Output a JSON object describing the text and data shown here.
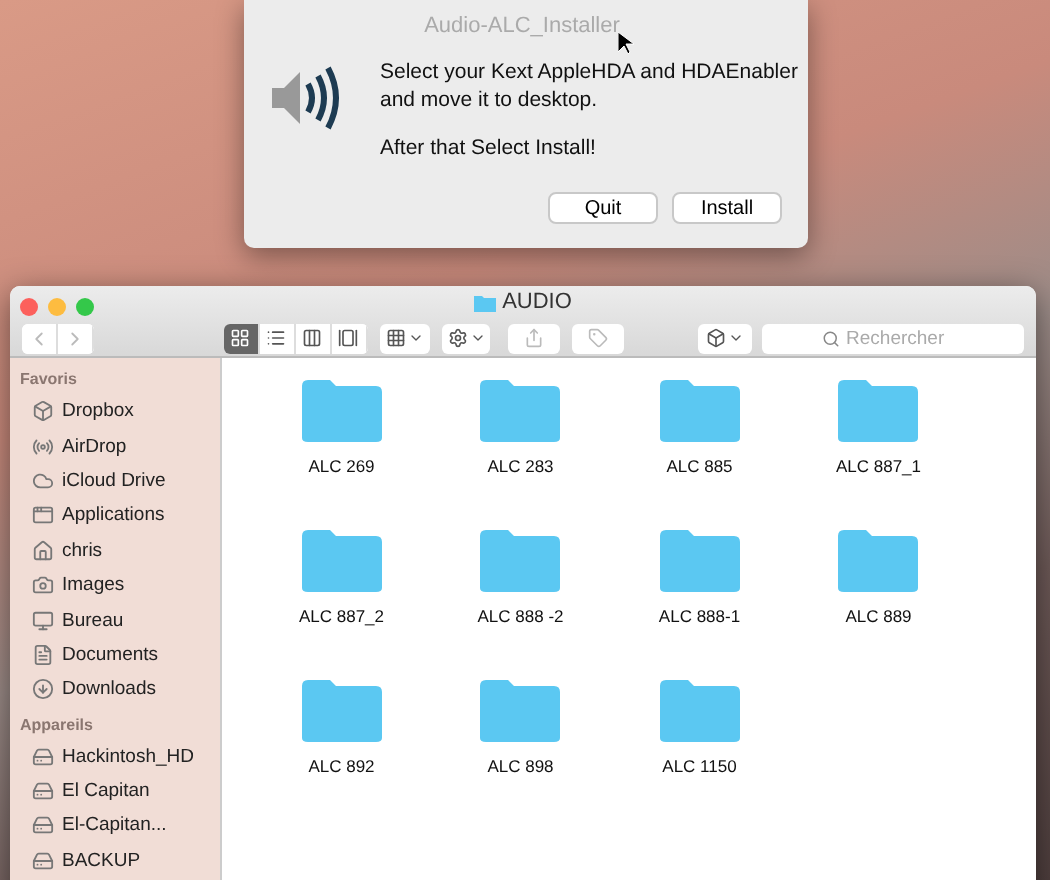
{
  "dialog": {
    "title": "Audio-ALC_Installer",
    "message_lines": [
      "Select your Kext AppleHDA and HDAEnabler",
      "and move it to desktop.",
      "After that Select Install!"
    ],
    "buttons": [
      "Quit",
      "Install"
    ]
  },
  "finder": {
    "title": "AUDIO",
    "view_modes": [
      {
        "selected": true
      },
      {
        "selected": false
      },
      {
        "selected": false
      },
      {
        "selected": false
      }
    ],
    "search": {
      "placeholder": "Rechercher"
    },
    "sidebar": [
      {
        "heading": "Favoris",
        "items": [
          "Dropbox",
          "AirDrop",
          "iCloud Drive",
          "Applications",
          "chris",
          "Images",
          "Bureau",
          "Documents",
          "Downloads"
        ]
      },
      {
        "heading": "Appareils",
        "items": [
          "Hackintosh_HD",
          "El Capitan",
          "El-Capitan...",
          "BACKUP"
        ]
      }
    ],
    "folders": [
      "ALC 269",
      "ALC 283",
      "ALC 885",
      "ALC 887_1",
      "ALC 887_2",
      "ALC 888 -2",
      "ALC 888-1",
      "ALC 889",
      "ALC 892",
      "ALC 898",
      "ALC 1150"
    ]
  }
}
